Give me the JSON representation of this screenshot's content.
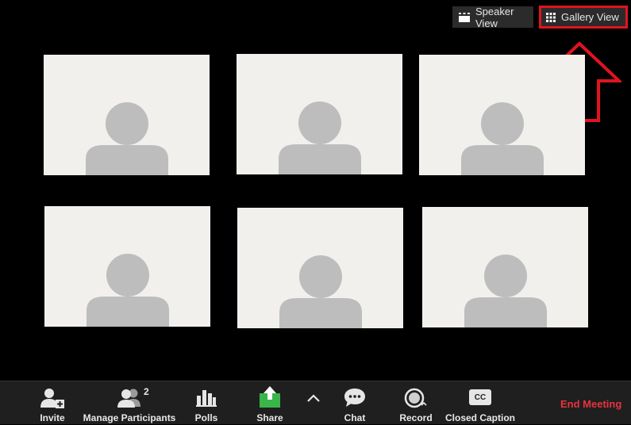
{
  "view_switcher": {
    "speaker_label": "Speaker View",
    "gallery_label": "Gallery View",
    "active": "Gallery View"
  },
  "annotation": {
    "color": "#e0141e",
    "shape": "arrow-up"
  },
  "gallery": {
    "tiles": [
      {
        "participant": "avatar-placeholder"
      },
      {
        "participant": "avatar-placeholder"
      },
      {
        "participant": "avatar-placeholder"
      },
      {
        "participant": "avatar-placeholder"
      },
      {
        "participant": "avatar-placeholder"
      },
      {
        "participant": "avatar-placeholder"
      }
    ]
  },
  "toolbar": {
    "invite_label": "Invite",
    "participants_label": "Manage Participants",
    "participants_count": "2",
    "polls_label": "Polls",
    "share_label": "Share",
    "chat_label": "Chat",
    "record_label": "Record",
    "cc_label": "Closed Caption",
    "cc_icon_text": "CC",
    "end_label": "End Meeting",
    "colors": {
      "share_accent": "#39b54a",
      "end_meeting": "#e8323e"
    }
  }
}
